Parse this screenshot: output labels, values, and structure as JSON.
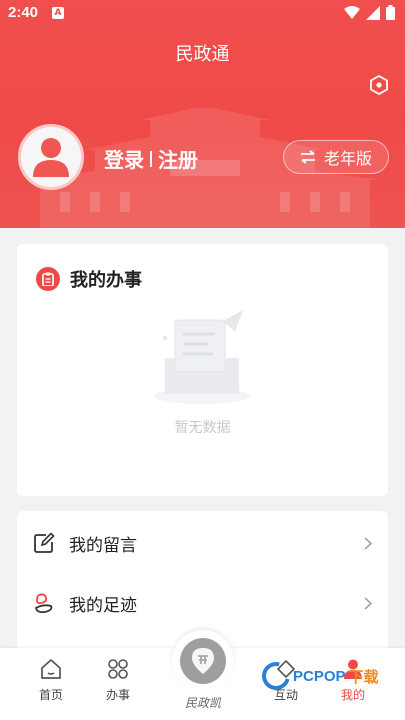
{
  "status_bar": {
    "time": "2:40",
    "app_icon_letter": "A"
  },
  "header": {
    "title": "民政通",
    "login_label": "登录",
    "register_label": "注册",
    "elder_mode_label": "老年版"
  },
  "affairs": {
    "title": "我的办事",
    "empty_text": "暂无数据"
  },
  "list": {
    "items": [
      {
        "label": "我的留言",
        "icon": "edit-icon"
      },
      {
        "label": "我的足迹",
        "icon": "footprint-icon"
      }
    ]
  },
  "bottom_nav": {
    "items": [
      {
        "label": "首页",
        "icon": "home-icon"
      },
      {
        "label": "办事",
        "icon": "grid-icon"
      },
      {
        "label": "民政凯",
        "icon": "map-pin-icon"
      },
      {
        "label": "互动",
        "icon": "chat-icon"
      },
      {
        "label": "我的",
        "icon": "person-icon",
        "active": true
      }
    ]
  },
  "watermark": {
    "brand": "PCPOP",
    "suffix": "下载"
  },
  "colors": {
    "primary": "#ef4a48",
    "background": "#f2f2f2",
    "card": "#ffffff",
    "watermark_blue": "#2b7fd4"
  }
}
